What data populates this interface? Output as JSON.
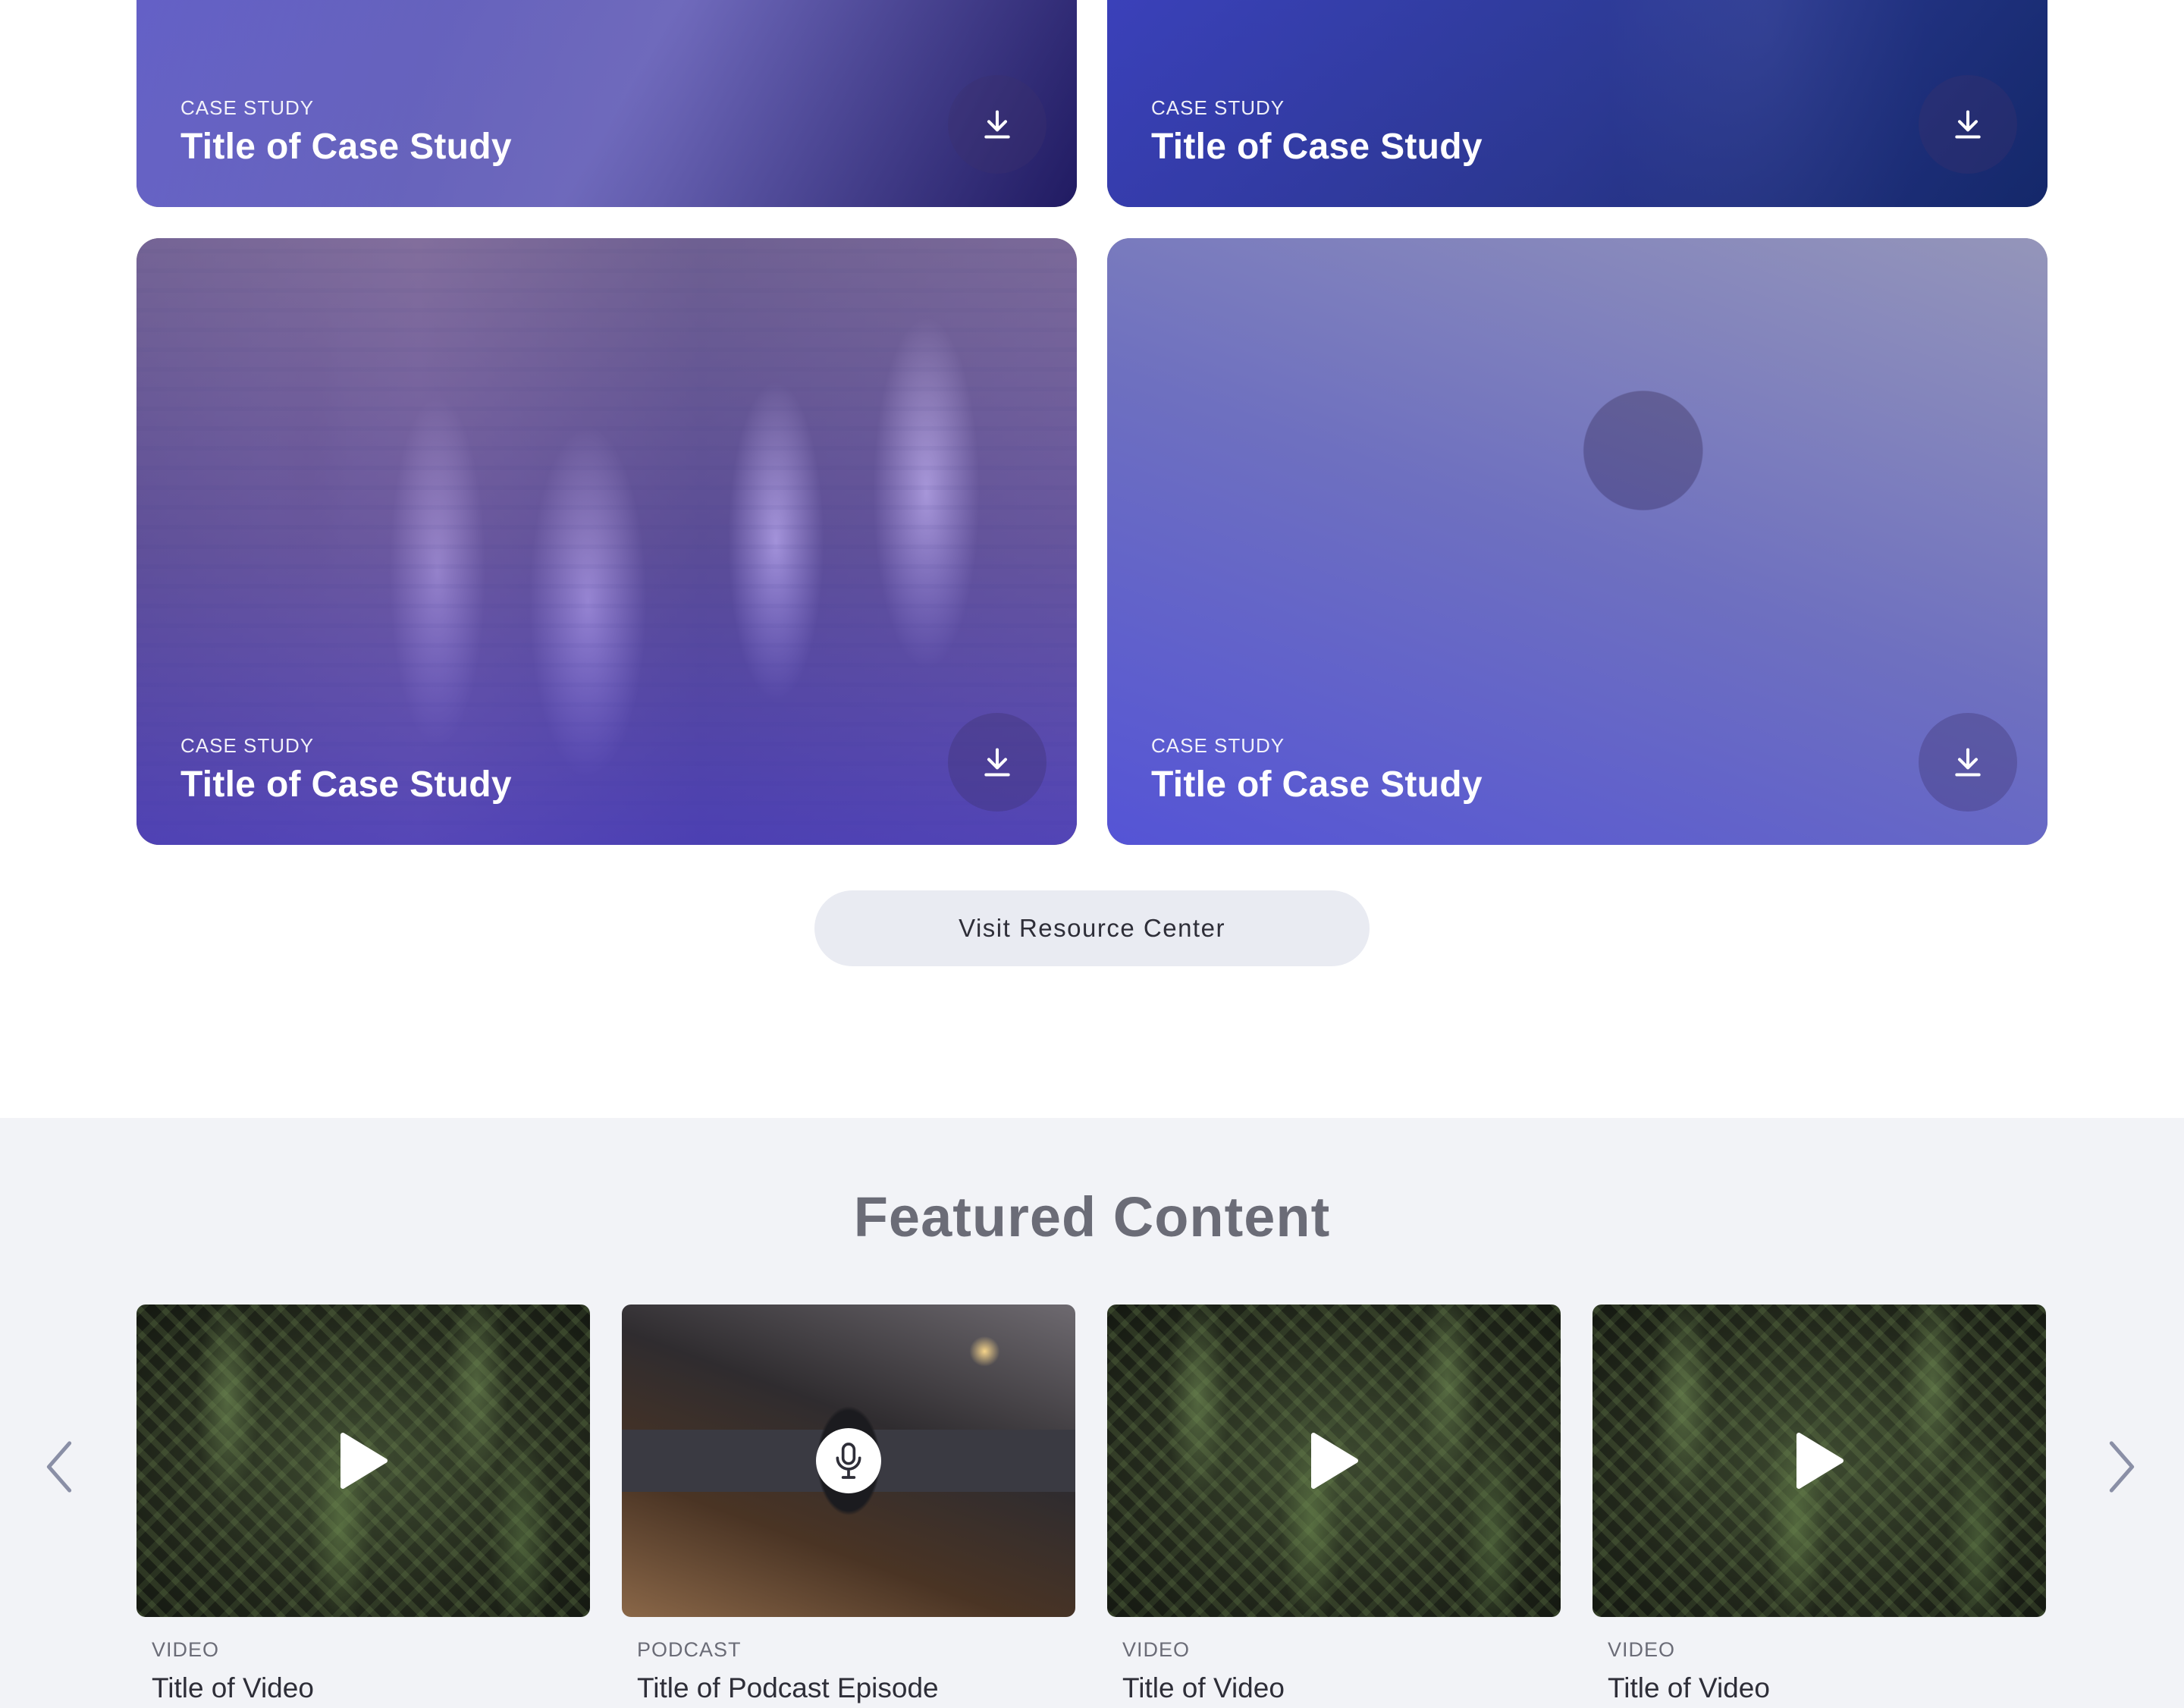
{
  "case_studies": [
    {
      "kind": "CASE STUDY",
      "title": "Title of Case Study"
    },
    {
      "kind": "CASE STUDY",
      "title": "Title of Case Study"
    },
    {
      "kind": "CASE STUDY",
      "title": "Title of Case Study"
    },
    {
      "kind": "CASE STUDY",
      "title": "Title of Case Study"
    }
  ],
  "visit_button": {
    "label": "Visit Resource Center"
  },
  "featured": {
    "title": "Featured Content",
    "items": [
      {
        "kind": "VIDEO",
        "title": "Title of Video",
        "icon": "play-icon"
      },
      {
        "kind": "PODCAST",
        "title": "Title of Podcast Episode",
        "icon": "microphone-icon"
      },
      {
        "kind": "VIDEO",
        "title": "Title of Video",
        "icon": "play-icon"
      },
      {
        "kind": "VIDEO",
        "title": "Title of Video",
        "icon": "play-icon"
      }
    ]
  },
  "colors": {
    "accent": "#5a5ae0",
    "section_bg": "#f2f3f7",
    "button_bg": "#e9ebf2",
    "heading": "#6b6c77",
    "text": "#2e2e38"
  }
}
